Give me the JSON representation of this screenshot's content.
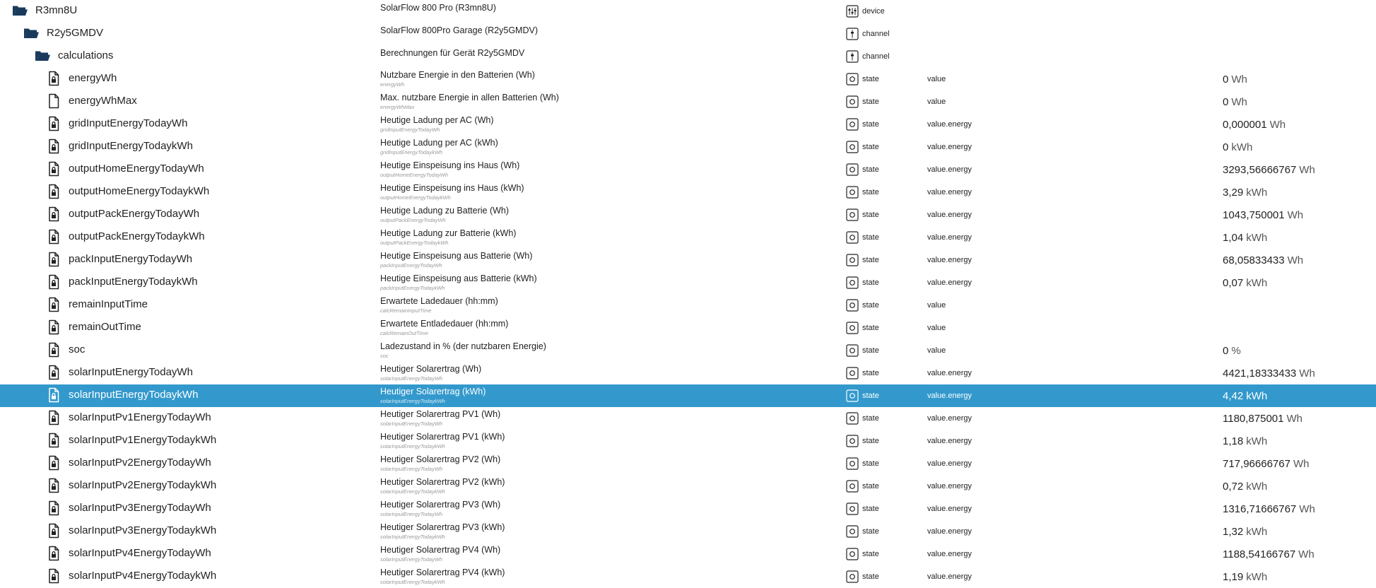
{
  "colors": {
    "selected_row_bg": "#3399cc",
    "selected_row_text": "#ffffff"
  },
  "folders": [
    {
      "name": "R3mn8U",
      "description": "SolarFlow 800 Pro (R3mn8U)",
      "type_icon": "device-icon",
      "type": "device"
    },
    {
      "name": "R2y5GMDV",
      "description": "SolarFlow 800Pro Garage (R2y5GMDV)",
      "type_icon": "channel-icon",
      "type": "channel"
    },
    {
      "name": "calculations",
      "description": "Berechnungen für Gerät R2y5GMDV",
      "type_icon": "channel-icon",
      "type": "channel"
    }
  ],
  "states": [
    {
      "name": "energyWh",
      "description": "Nutzbare Energie in den Batterien (Wh)",
      "sub": "energyWh",
      "type": "state",
      "role": "value",
      "value": "0",
      "unit": "Wh",
      "icon": "locked-file-icon",
      "selected": false
    },
    {
      "name": "energyWhMax",
      "description": "Max. nutzbare Energie in allen Batterien (Wh)",
      "sub": "energyWhMax",
      "type": "state",
      "role": "value",
      "value": "0",
      "unit": "Wh",
      "icon": "file-icon",
      "selected": false
    },
    {
      "name": "gridInputEnergyTodayWh",
      "description": "Heutige Ladung per AC (Wh)",
      "sub": "gridInputEnergyTodayWh",
      "type": "state",
      "role": "value.energy",
      "value": "0,000001",
      "unit": "Wh",
      "icon": "locked-file-icon",
      "selected": false
    },
    {
      "name": "gridInputEnergyTodaykWh",
      "description": "Heutige Ladung per AC (kWh)",
      "sub": "gridInputEnergyTodaykWh",
      "type": "state",
      "role": "value.energy",
      "value": "0",
      "unit": "kWh",
      "icon": "locked-file-icon",
      "selected": false
    },
    {
      "name": "outputHomeEnergyTodayWh",
      "description": "Heutige Einspeisung ins Haus (Wh)",
      "sub": "outputHomeEnergyTodayWh",
      "type": "state",
      "role": "value.energy",
      "value": "3293,56666767",
      "unit": "Wh",
      "icon": "locked-file-icon",
      "selected": false
    },
    {
      "name": "outputHomeEnergyTodaykWh",
      "description": "Heutige Einspeisung ins Haus (kWh)",
      "sub": "outputHomeEnergyTodaykWh",
      "type": "state",
      "role": "value.energy",
      "value": "3,29",
      "unit": "kWh",
      "icon": "locked-file-icon",
      "selected": false
    },
    {
      "name": "outputPackEnergyTodayWh",
      "description": "Heutige Ladung zu Batterie (Wh)",
      "sub": "outputPackEnergyTodayWh",
      "type": "state",
      "role": "value.energy",
      "value": "1043,750001",
      "unit": "Wh",
      "icon": "locked-file-icon",
      "selected": false
    },
    {
      "name": "outputPackEnergyTodaykWh",
      "description": "Heutige Ladung zur Batterie (kWh)",
      "sub": "outputPackEnergyTodaykWh",
      "type": "state",
      "role": "value.energy",
      "value": "1,04",
      "unit": "kWh",
      "icon": "locked-file-icon",
      "selected": false
    },
    {
      "name": "packInputEnergyTodayWh",
      "description": "Heutige Einspeisung aus Batterie (Wh)",
      "sub": "packInputEnergyTodayWh",
      "type": "state",
      "role": "value.energy",
      "value": "68,05833433",
      "unit": "Wh",
      "icon": "locked-file-icon",
      "selected": false
    },
    {
      "name": "packInputEnergyTodaykWh",
      "description": "Heutige Einspeisung aus Batterie (kWh)",
      "sub": "packInputEnergyTodaykWh",
      "type": "state",
      "role": "value.energy",
      "value": "0,07",
      "unit": "kWh",
      "icon": "locked-file-icon",
      "selected": false
    },
    {
      "name": "remainInputTime",
      "description": "Erwartete Ladedauer (hh:mm)",
      "sub": "calcRemainInputTime",
      "type": "state",
      "role": "value",
      "value": "",
      "unit": "",
      "icon": "locked-file-icon",
      "selected": false
    },
    {
      "name": "remainOutTime",
      "description": "Erwartete Entladedauer (hh:mm)",
      "sub": "calcRemainOutTime",
      "type": "state",
      "role": "value",
      "value": "",
      "unit": "",
      "icon": "locked-file-icon",
      "selected": false
    },
    {
      "name": "soc",
      "description": "Ladezustand in % (der nutzbaren Energie)",
      "sub": "soc",
      "type": "state",
      "role": "value",
      "value": "0",
      "unit": "%",
      "icon": "locked-file-icon",
      "selected": false
    },
    {
      "name": "solarInputEnergyTodayWh",
      "description": "Heutiger Solarertrag (Wh)",
      "sub": "solarInputEnergyTodayWh",
      "type": "state",
      "role": "value.energy",
      "value": "4421,18333433",
      "unit": "Wh",
      "icon": "locked-file-icon",
      "selected": false
    },
    {
      "name": "solarInputEnergyTodaykWh",
      "description": "Heutiger Solarertrag (kWh)",
      "sub": "solarInputEnergyTodaykWh",
      "type": "state",
      "role": "value.energy",
      "value": "4,42",
      "unit": "kWh",
      "icon": "locked-file-icon",
      "selected": true
    },
    {
      "name": "solarInputPv1EnergyTodayWh",
      "description": "Heutiger Solarertrag PV1 (Wh)",
      "sub": "solarInputEnergyTodayWh",
      "type": "state",
      "role": "value.energy",
      "value": "1180,875001",
      "unit": "Wh",
      "icon": "locked-file-icon",
      "selected": false
    },
    {
      "name": "solarInputPv1EnergyTodaykWh",
      "description": "Heutiger Solarertrag PV1 (kWh)",
      "sub": "solarInputEnergyTodaykWh",
      "type": "state",
      "role": "value.energy",
      "value": "1,18",
      "unit": "kWh",
      "icon": "locked-file-icon",
      "selected": false
    },
    {
      "name": "solarInputPv2EnergyTodayWh",
      "description": "Heutiger Solarertrag PV2 (Wh)",
      "sub": "solarInputEnergyTodayWh",
      "type": "state",
      "role": "value.energy",
      "value": "717,96666767",
      "unit": "Wh",
      "icon": "locked-file-icon",
      "selected": false
    },
    {
      "name": "solarInputPv2EnergyTodaykWh",
      "description": "Heutiger Solarertrag PV2 (kWh)",
      "sub": "solarInputEnergyTodaykWh",
      "type": "state",
      "role": "value.energy",
      "value": "0,72",
      "unit": "kWh",
      "icon": "locked-file-icon",
      "selected": false
    },
    {
      "name": "solarInputPv3EnergyTodayWh",
      "description": "Heutiger Solarertrag PV3 (Wh)",
      "sub": "solarInputEnergyTodayWh",
      "type": "state",
      "role": "value.energy",
      "value": "1316,71666767",
      "unit": "Wh",
      "icon": "locked-file-icon",
      "selected": false
    },
    {
      "name": "solarInputPv3EnergyTodaykWh",
      "description": "Heutiger Solarertrag PV3 (kWh)",
      "sub": "solarInputEnergyTodaykWh",
      "type": "state",
      "role": "value.energy",
      "value": "1,32",
      "unit": "kWh",
      "icon": "locked-file-icon",
      "selected": false
    },
    {
      "name": "solarInputPv4EnergyTodayWh",
      "description": "Heutiger Solarertrag PV4 (Wh)",
      "sub": "solarInputEnergyTodayWh",
      "type": "state",
      "role": "value.energy",
      "value": "1188,54166767",
      "unit": "Wh",
      "icon": "locked-file-icon",
      "selected": false
    },
    {
      "name": "solarInputPv4EnergyTodaykWh",
      "description": "Heutiger Solarertrag PV4 (kWh)",
      "sub": "solarInputEnergyTodaykWh",
      "type": "state",
      "role": "value.energy",
      "value": "1,19",
      "unit": "kWh",
      "icon": "locked-file-icon",
      "selected": false
    }
  ]
}
